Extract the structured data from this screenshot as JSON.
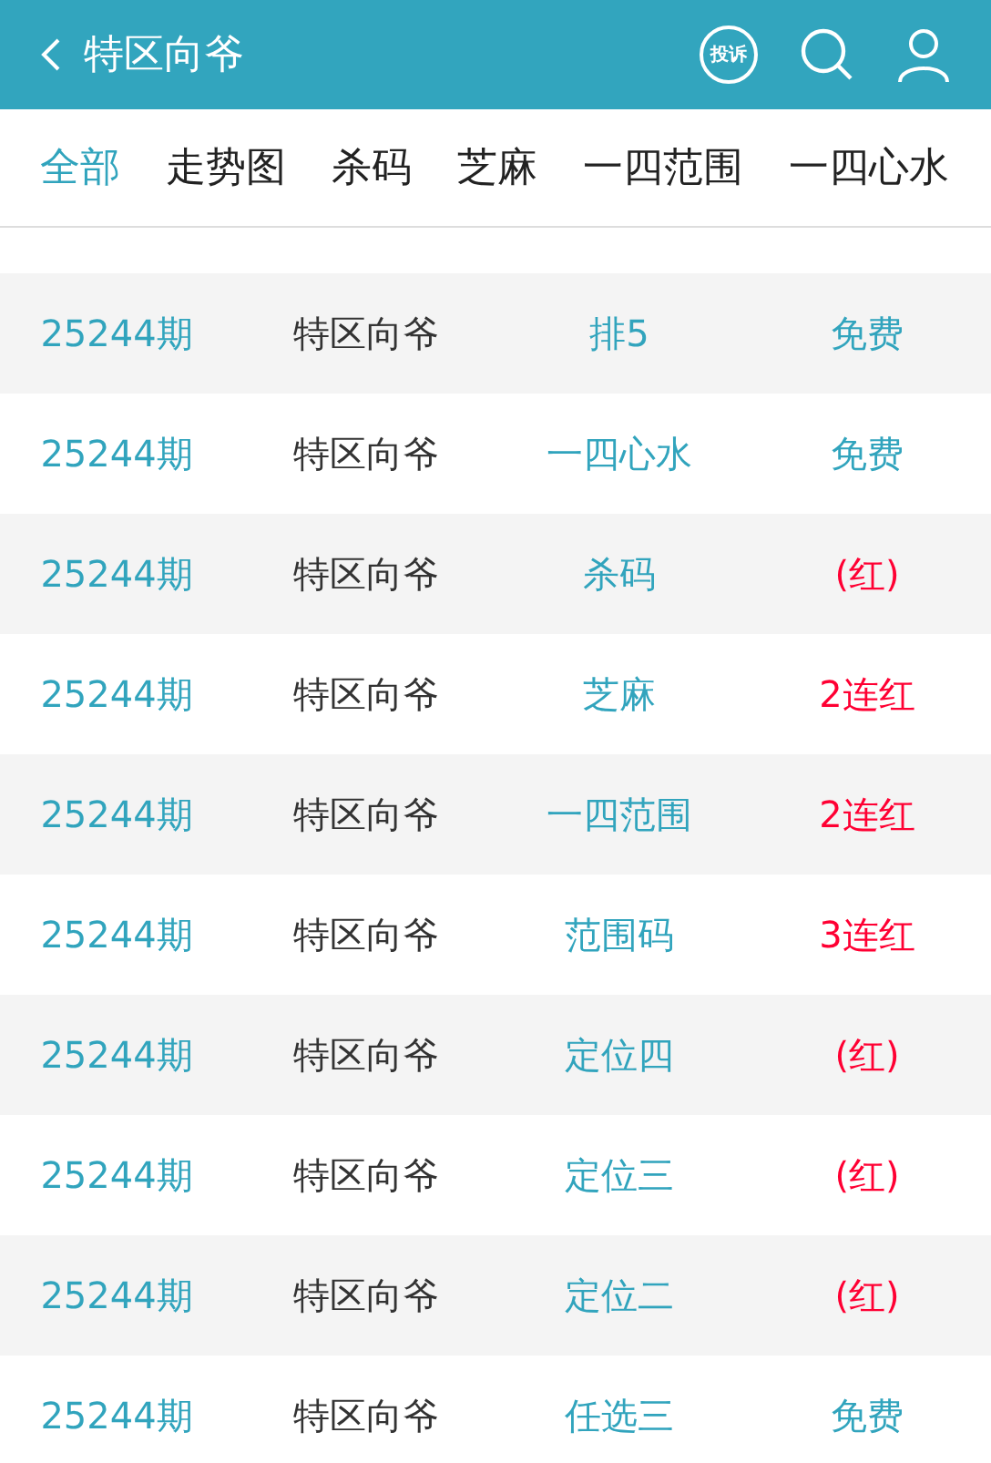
{
  "header": {
    "title": "特区向爷",
    "complaint_label": "投诉"
  },
  "tabs": [
    {
      "label": "全部",
      "selected": true
    },
    {
      "label": "走势图",
      "selected": false
    },
    {
      "label": "杀码",
      "selected": false
    },
    {
      "label": "芝麻",
      "selected": false
    },
    {
      "label": "一四范围",
      "selected": false
    },
    {
      "label": "一四心水",
      "selected": false
    }
  ],
  "rows": [
    {
      "period": "25244期",
      "author": "特区向爷",
      "category": "排5",
      "result": "免费",
      "kind": "free"
    },
    {
      "period": "25244期",
      "author": "特区向爷",
      "category": "一四心水",
      "result": "免费",
      "kind": "free"
    },
    {
      "period": "25244期",
      "author": "特区向爷",
      "category": "杀码",
      "result": "(红)",
      "kind": "win"
    },
    {
      "period": "25244期",
      "author": "特区向爷",
      "category": "芝麻",
      "result": "2连红",
      "kind": "win"
    },
    {
      "period": "25244期",
      "author": "特区向爷",
      "category": "一四范围",
      "result": "2连红",
      "kind": "win"
    },
    {
      "period": "25244期",
      "author": "特区向爷",
      "category": "范围码",
      "result": "3连红",
      "kind": "win"
    },
    {
      "period": "25244期",
      "author": "特区向爷",
      "category": "定位四",
      "result": "(红)",
      "kind": "win"
    },
    {
      "period": "25244期",
      "author": "特区向爷",
      "category": "定位三",
      "result": "(红)",
      "kind": "win"
    },
    {
      "period": "25244期",
      "author": "特区向爷",
      "category": "定位二",
      "result": "(红)",
      "kind": "win"
    },
    {
      "period": "25244期",
      "author": "特区向爷",
      "category": "任选三",
      "result": "免费",
      "kind": "free"
    }
  ]
}
